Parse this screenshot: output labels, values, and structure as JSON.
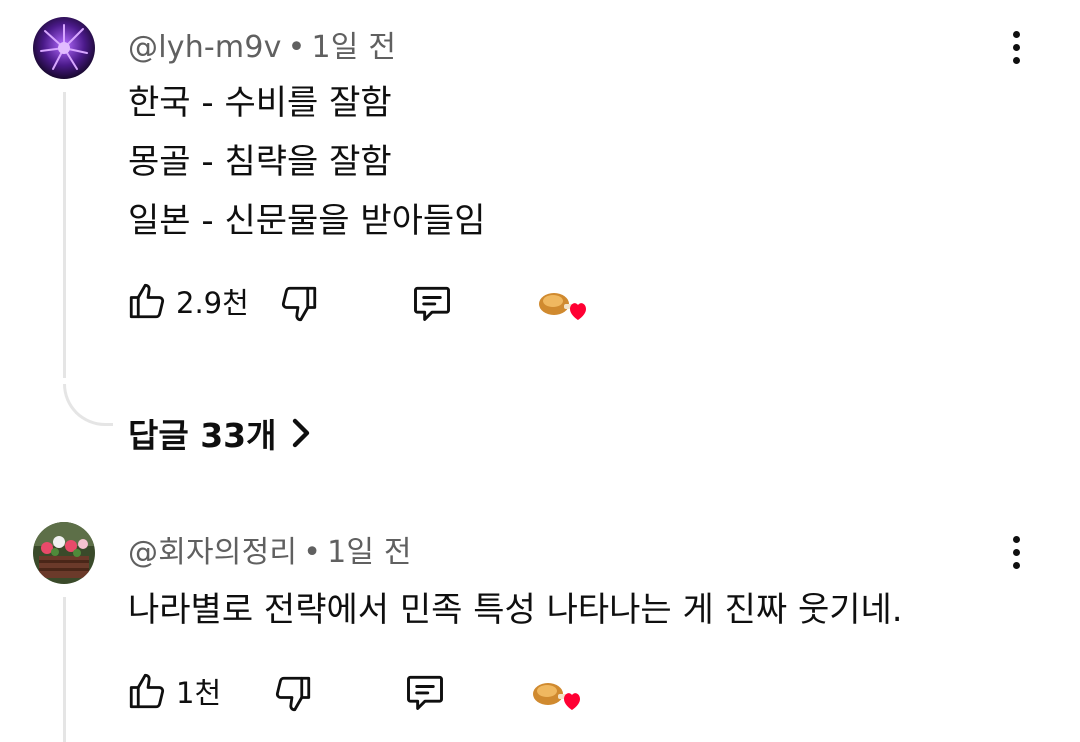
{
  "comments": [
    {
      "handle": "@lyh-m9v",
      "separator": "•",
      "time": "1일 전",
      "lines": [
        "한국 - 수비를 잘함",
        "몽골 - 침략을 잘함",
        "일본 - 신문물을 받아들임"
      ],
      "likes": "2.9천",
      "replies_label": "답글 33개",
      "avatar": "purple-flower",
      "creator_heart": true
    },
    {
      "handle": "@회자의정리",
      "separator": "•",
      "time": "1일 전",
      "lines": [
        "나라별로 전략에서 민족 특성 나타나는 게 진짜 웃기네."
      ],
      "likes": "1천",
      "avatar": "flower-basket",
      "creator_heart": true
    }
  ],
  "icons": {
    "like": "thumbs-up-icon",
    "dislike": "thumbs-down-icon",
    "reply": "reply-comment-icon",
    "menu": "more-vertical-icon",
    "heart": "creator-heart-icon",
    "chevron": "chevron-right-icon"
  },
  "colors": {
    "text": "#0f0f0f",
    "meta": "#606060",
    "heart": "#ff0033",
    "thread": "#e5e5e5"
  }
}
